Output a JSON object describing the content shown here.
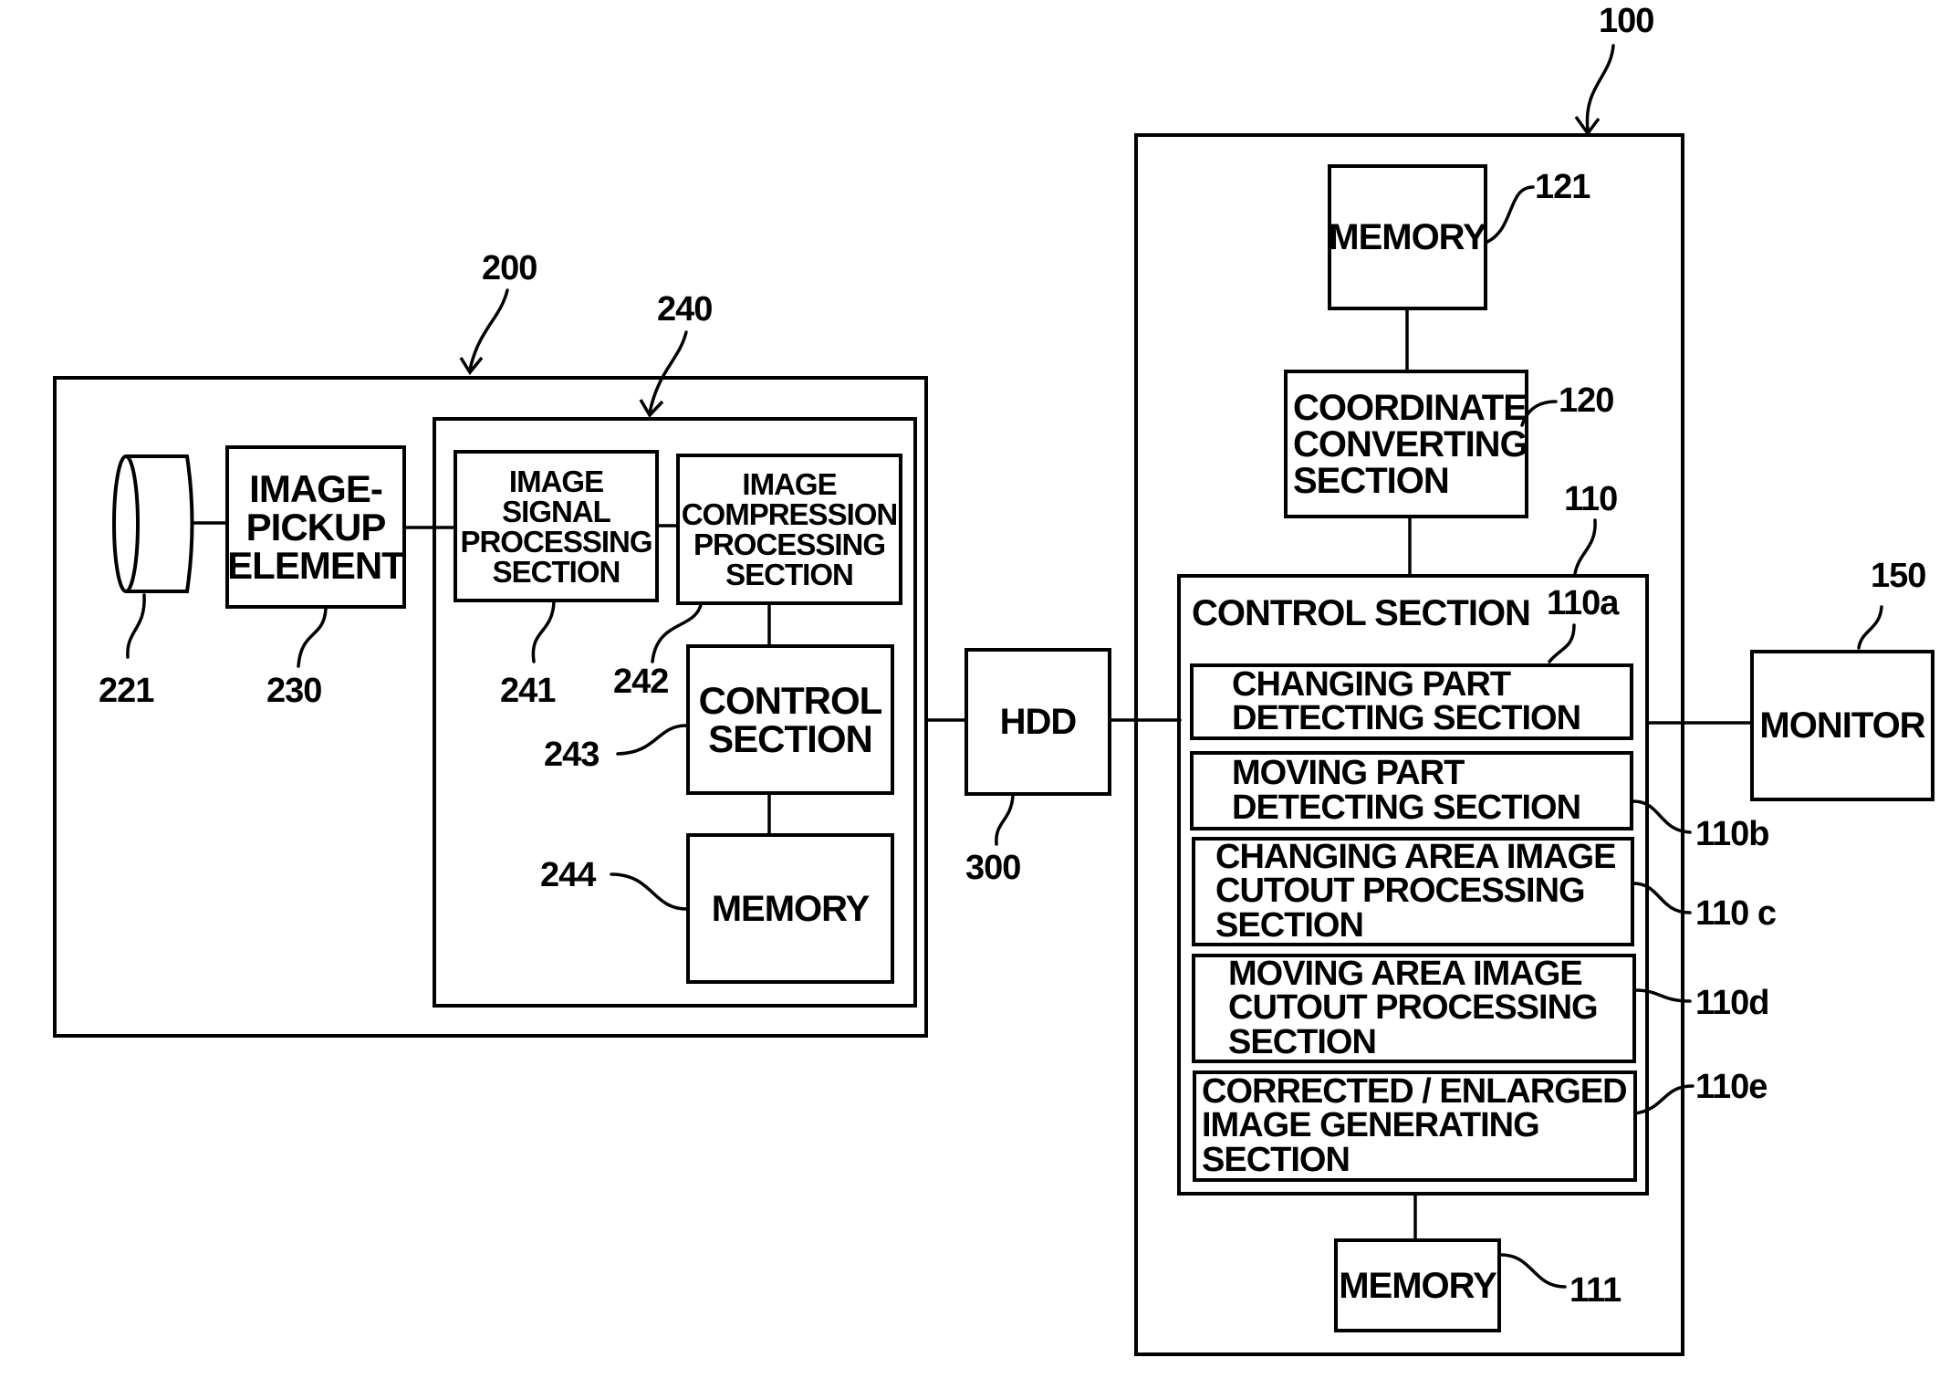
{
  "diagram": {
    "camera_unit": {
      "ref": "200",
      "lens": {
        "ref": "221",
        "icon": "lens-icon"
      },
      "image_pickup_element": {
        "ref": "230",
        "label": "IMAGE-\nPICKUP\nELEMENT"
      },
      "processing_unit": {
        "ref": "240",
        "image_signal_processing": {
          "ref": "241",
          "label": "IMAGE\nSIGNAL\nPROCESSING\nSECTION"
        },
        "image_compression_processing": {
          "ref": "242",
          "label": "IMAGE\nCOMPRESSION\nPROCESSING\nSECTION"
        },
        "control_section": {
          "ref": "243",
          "label": "CONTROL\nSECTION"
        },
        "memory": {
          "ref": "244",
          "label": "MEMORY"
        }
      }
    },
    "hdd": {
      "ref": "300",
      "label": "HDD"
    },
    "image_processing_device": {
      "ref": "100",
      "memory_top": {
        "ref": "121",
        "label": "MEMORY"
      },
      "coordinate_converting": {
        "ref": "120",
        "label": "COORDINATE\nCONVERTING\nSECTION"
      },
      "control_section": {
        "ref": "110",
        "title": "CONTROL SECTION",
        "subsections": [
          {
            "ref": "110a",
            "label": "CHANGING PART\nDETECTING SECTION"
          },
          {
            "ref": "110b",
            "label": "MOVING PART\nDETECTING SECTION"
          },
          {
            "ref": "110 c",
            "label": "CHANGING AREA IMAGE\nCUTOUT PROCESSING\nSECTION"
          },
          {
            "ref": "110d",
            "label": "MOVING AREA IMAGE\nCUTOUT PROCESSING\nSECTION"
          },
          {
            "ref": "110e",
            "label": "CORRECTED / ENLARGED\nIMAGE GENERATING\nSECTION"
          }
        ]
      },
      "memory_bottom": {
        "ref": "111",
        "label": "MEMORY"
      }
    },
    "monitor": {
      "ref": "150",
      "label": "MONITOR"
    }
  }
}
